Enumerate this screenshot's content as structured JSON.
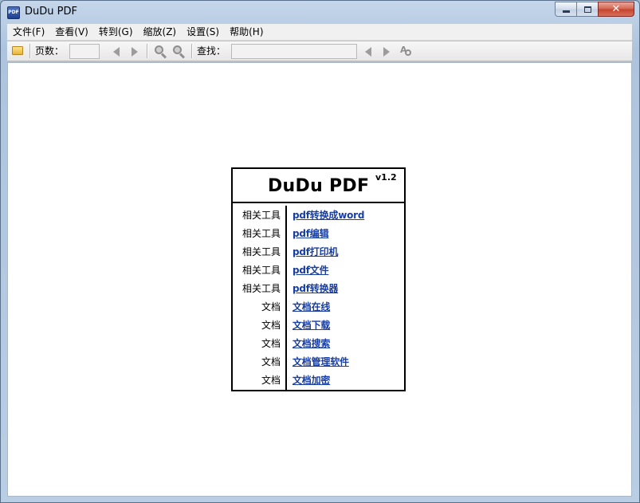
{
  "window": {
    "title": "DuDu PDF",
    "app_icon_text": "PDF",
    "controls": {
      "minimize": "—",
      "maximize": "□",
      "close": "✕"
    }
  },
  "menu": [
    {
      "label": "文件(F)"
    },
    {
      "label": "查看(V)"
    },
    {
      "label": "转到(G)"
    },
    {
      "label": "缩放(Z)"
    },
    {
      "label": "设置(S)"
    },
    {
      "label": "帮助(H)"
    }
  ],
  "toolbar": {
    "page_label": "页数：",
    "page_value": "",
    "find_label": "查找：",
    "find_value": ""
  },
  "about": {
    "title": "DuDu PDF",
    "version": "v1.2",
    "rows": [
      {
        "category": "相关工具",
        "link": "pdf转换成word"
      },
      {
        "category": "相关工具",
        "link": "pdf编辑"
      },
      {
        "category": "相关工具",
        "link": "pdf打印机"
      },
      {
        "category": "相关工具",
        "link": "pdf文件"
      },
      {
        "category": "相关工具",
        "link": "pdf转换器"
      },
      {
        "category": "文档",
        "link": "文档在线"
      },
      {
        "category": "文档",
        "link": "文档下载"
      },
      {
        "category": "文档",
        "link": "文档搜索"
      },
      {
        "category": "文档",
        "link": "文档管理软件"
      },
      {
        "category": "文档",
        "link": "文档加密"
      }
    ]
  },
  "colors": {
    "link": "#1a3fa3",
    "chrome": "#b9cde4",
    "close_button": "#c6412a"
  }
}
